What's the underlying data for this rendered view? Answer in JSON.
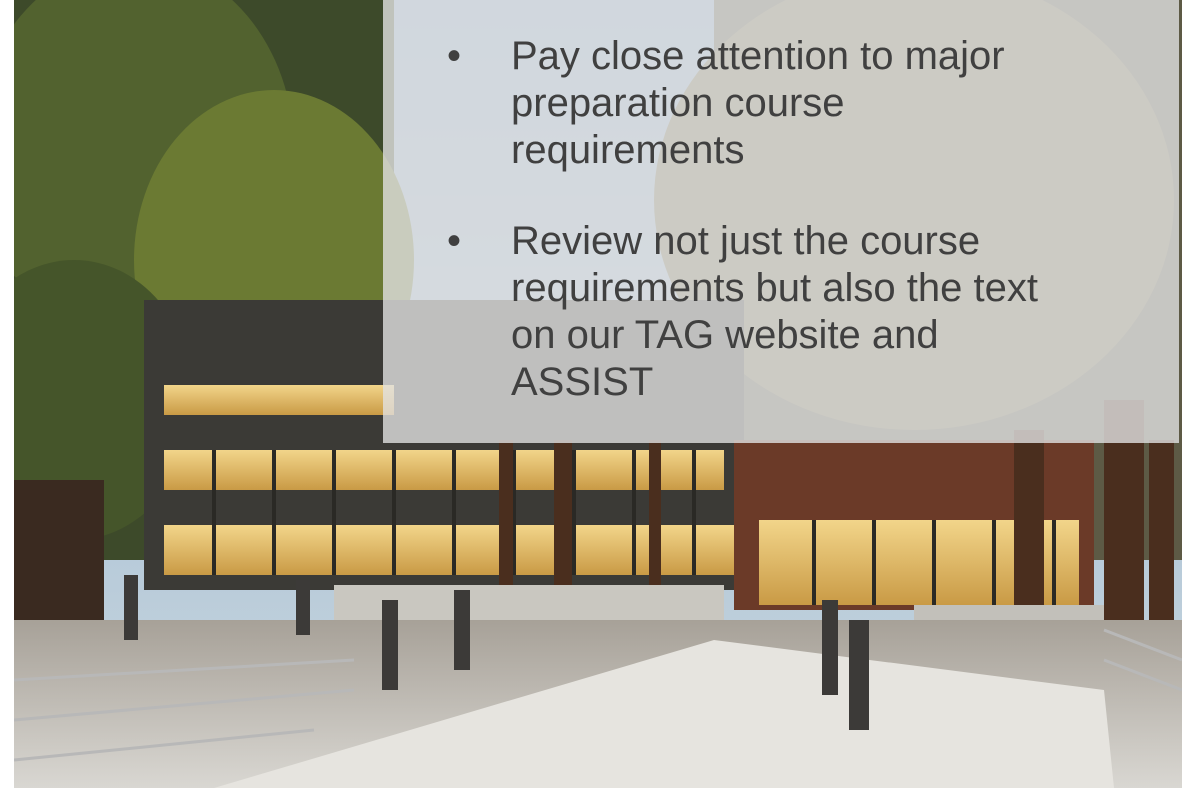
{
  "slide": {
    "bullets": [
      {
        "marker": "•",
        "text": "Pay close attention to major preparation course requirements"
      },
      {
        "marker": "•",
        "text": "Review not just the course requirements but also the text on our TAG website and ASSIST"
      }
    ]
  }
}
